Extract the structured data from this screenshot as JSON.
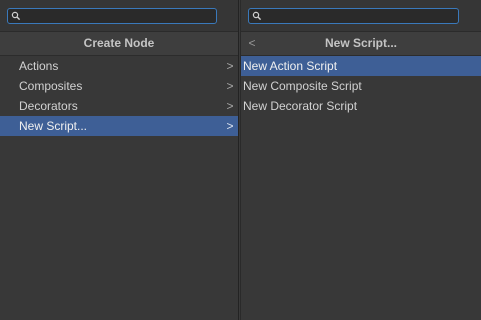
{
  "left_panel": {
    "search": {
      "value": "",
      "placeholder": ""
    },
    "header": {
      "title": "Create Node"
    },
    "items": [
      {
        "label": "Actions",
        "has_submenu": true,
        "selected": false
      },
      {
        "label": "Composites",
        "has_submenu": true,
        "selected": false
      },
      {
        "label": "Decorators",
        "has_submenu": true,
        "selected": false
      },
      {
        "label": "New Script...",
        "has_submenu": true,
        "selected": true
      }
    ]
  },
  "right_panel": {
    "search": {
      "value": "",
      "placeholder": ""
    },
    "header": {
      "title": "New Script...",
      "back_glyph": "<"
    },
    "items": [
      {
        "label": "New Action Script",
        "selected": true
      },
      {
        "label": "New Composite Script",
        "selected": false
      },
      {
        "label": "New Decorator Script",
        "selected": false
      }
    ]
  },
  "glyphs": {
    "submenu_chevron": ">"
  },
  "colors": {
    "background": "#383838",
    "selection": "#3e5f96",
    "search_border": "#3a79bb",
    "text": "#d2d2d2"
  }
}
